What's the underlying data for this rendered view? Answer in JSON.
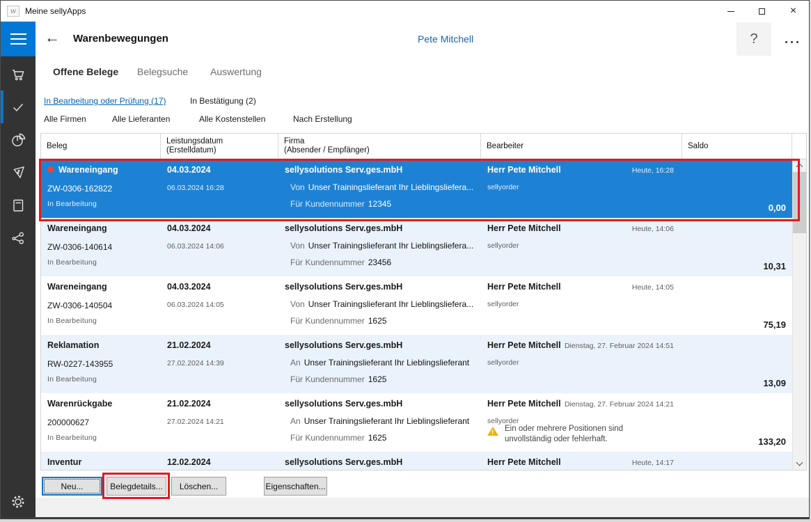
{
  "window": {
    "title": "Meine sellyApps"
  },
  "header": {
    "title": "Warenbewegungen",
    "user": "Pete Mitchell",
    "help_label": "?"
  },
  "sidebar": {
    "items": [
      {
        "icon": "cart-icon",
        "active": false
      },
      {
        "icon": "check-icon",
        "active": true
      },
      {
        "icon": "pie-chart-icon",
        "active": false
      },
      {
        "icon": "tag-icon",
        "active": false
      },
      {
        "icon": "book-icon",
        "active": false
      },
      {
        "icon": "share-icon",
        "active": false
      }
    ],
    "settings_icon": "gear-icon"
  },
  "tabs": [
    {
      "label": "Offene Belege",
      "active": true
    },
    {
      "label": "Belegsuche",
      "active": false
    },
    {
      "label": "Auswertung",
      "active": false
    }
  ],
  "filters": {
    "status": [
      {
        "label": "In Bearbeitung oder Prüfung (17)",
        "active": true
      },
      {
        "label": "In Bestätigung (2)",
        "active": false
      }
    ],
    "dropdowns": [
      {
        "label": "Alle Firmen"
      },
      {
        "label": "Alle Lieferanten"
      },
      {
        "label": "Alle Kostenstellen"
      },
      {
        "label": "Nach Erstellung"
      }
    ]
  },
  "table": {
    "columns": [
      {
        "line1": "Beleg",
        "line2": ""
      },
      {
        "line1": "Leistungsdatum",
        "line2": "(Erstelldatum)"
      },
      {
        "line1": "Firma",
        "line2": "(Absender / Empfänger)"
      },
      {
        "line1": "Bearbeiter",
        "line2": ""
      },
      {
        "line1": "Saldo",
        "line2": ""
      }
    ],
    "rows": [
      {
        "selected": true,
        "new_dot": true,
        "type": "Wareneingang",
        "number": "ZW-0306-162822",
        "status": "In Bearbeitung",
        "date": "04.03.2024",
        "created": "06.03.2024 16:28",
        "company": "sellysolutions Serv.ges.mbH",
        "direction": "Von",
        "partner": "Unser Trainingslieferant Ihr Lieblingsliefera...",
        "customer_label": "Für Kundennummer",
        "customer_no": "12345",
        "editor": "Herr Pete Mitchell",
        "editor_sub": "sellyorder",
        "time": "Heute, 16:28",
        "saldo": "0,00"
      },
      {
        "type": "Wareneingang",
        "number": "ZW-0306-140614",
        "status": "In Bearbeitung",
        "date": "04.03.2024",
        "created": "06.03.2024 14:06",
        "company": "sellysolutions Serv.ges.mbH",
        "direction": "Von",
        "partner": "Unser Trainingslieferant Ihr Lieblingsliefera...",
        "customer_label": "Für Kundennummer",
        "customer_no": "23456",
        "editor": "Herr Pete Mitchell",
        "editor_sub": "sellyorder",
        "time": "Heute, 14:06",
        "saldo": "10,31"
      },
      {
        "type": "Wareneingang",
        "number": "ZW-0306-140504",
        "status": "In Bearbeitung",
        "date": "04.03.2024",
        "created": "06.03.2024 14:05",
        "company": "sellysolutions Serv.ges.mbH",
        "direction": "Von",
        "partner": "Unser Trainingslieferant Ihr Lieblingsliefera...",
        "customer_label": "Für Kundennummer",
        "customer_no": "1625",
        "editor": "Herr Pete Mitchell",
        "editor_sub": "sellyorder",
        "time": "Heute, 14:05",
        "saldo": "75,19"
      },
      {
        "type": "Reklamation",
        "number": "RW-0227-143955",
        "status": "In Bearbeitung",
        "date": "21.02.2024",
        "created": "27.02.2024 14:39",
        "company": "sellysolutions Serv.ges.mbH",
        "direction": "An",
        "partner": "Unser Trainingslieferant Ihr Lieblingslieferant",
        "customer_label": "Für Kundennummer",
        "customer_no": "1625",
        "editor": "Herr Pete Mitchell",
        "editor_sub": "sellyorder",
        "time": "Dienstag, 27. Februar 2024 14:51",
        "saldo": "13,09"
      },
      {
        "type": "Warenrückgabe",
        "number": "200000627",
        "status": "In Bearbeitung",
        "date": "21.02.2024",
        "created": "27.02.2024 14:21",
        "company": "sellysolutions Serv.ges.mbH",
        "direction": "An",
        "partner": "Unser Trainingslieferant Ihr Lieblingslieferant",
        "customer_label": "Für Kundennummer",
        "customer_no": "1625",
        "editor": "Herr Pete Mitchell",
        "editor_sub": "sellyorder",
        "time": "Dienstag, 27. Februar 2024 14:21",
        "warning": "Ein oder mehrere Positionen sind unvollständig oder fehlerhaft.",
        "saldo": "133,20"
      },
      {
        "type": "Inventur",
        "date": "12.02.2024",
        "company": "sellysolutions Serv.ges.mbH",
        "editor": "Herr Pete Mitchell",
        "time": "Heute, 14:17"
      }
    ]
  },
  "actions": [
    {
      "label": "Neu...",
      "default": true
    },
    {
      "label": "Belegdetails...",
      "annotated": true
    },
    {
      "label": "Löschen..."
    },
    {
      "label": "Eigenschaften..."
    }
  ],
  "colors": {
    "accent": "#0078d4",
    "selected_row": "#1e82d4",
    "row_alt": "#eaf3fc",
    "annotation": "#e11b22",
    "warning": "#f0b400",
    "link": "#0a61ab",
    "username": "#1763af",
    "dot": "#e8443a",
    "sidebar_bg": "#333333"
  }
}
